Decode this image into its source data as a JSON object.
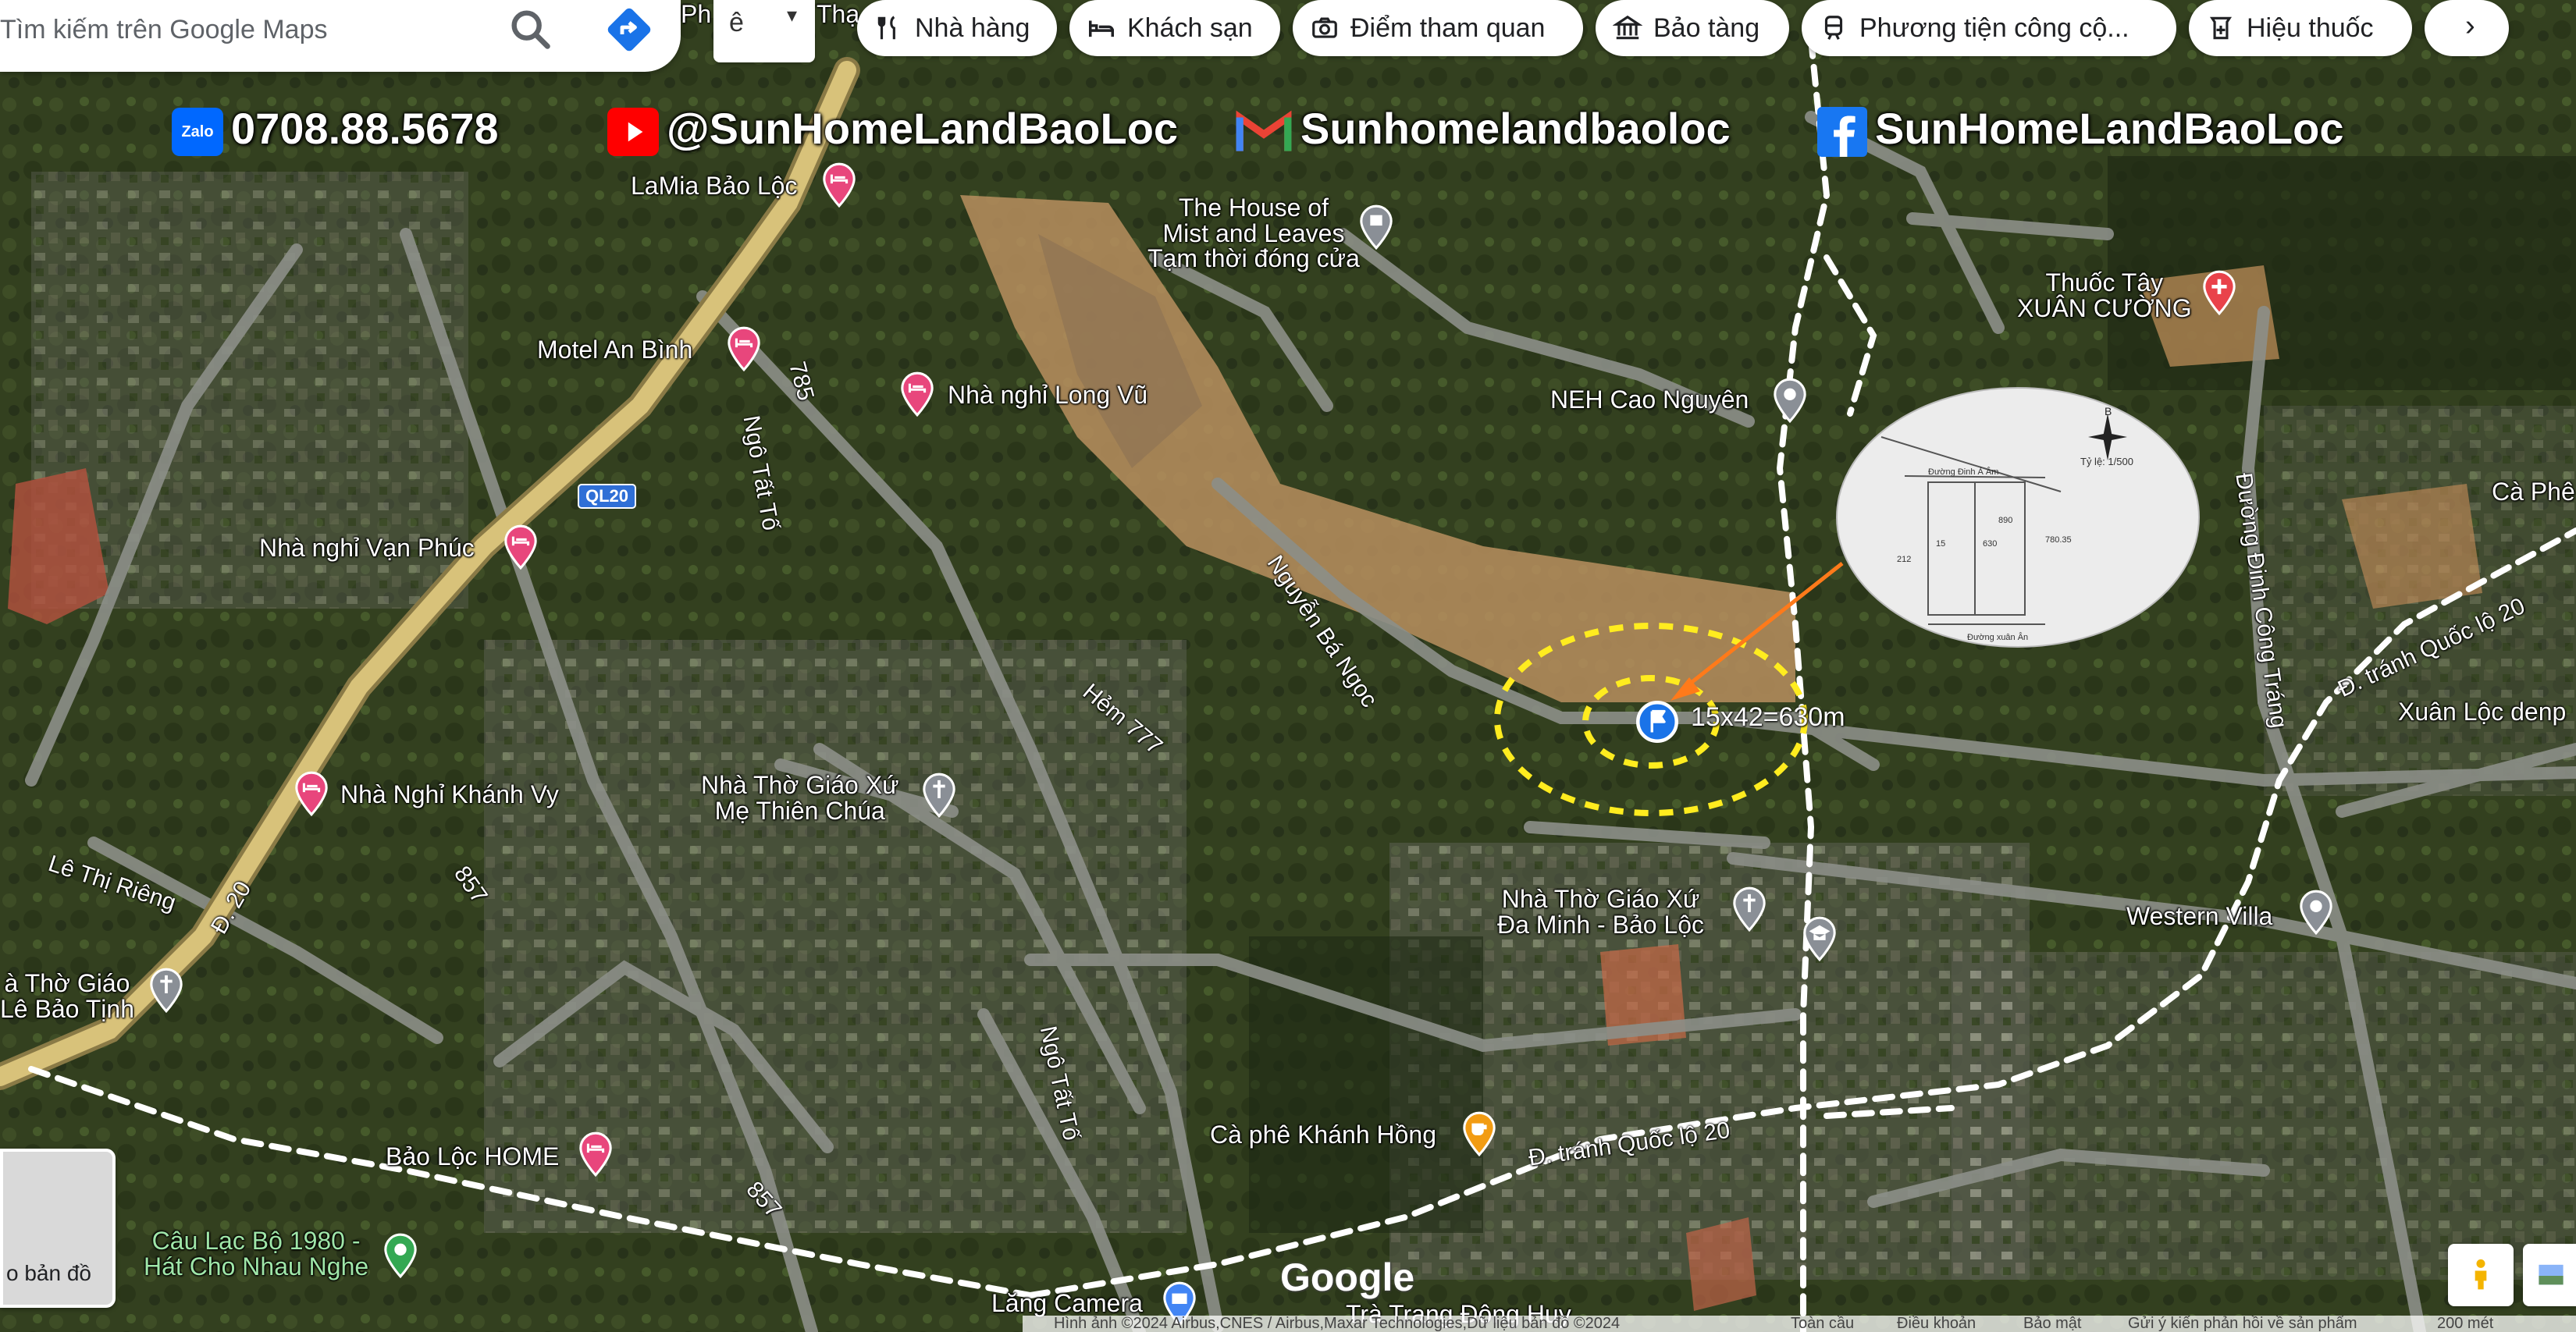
{
  "search": {
    "placeholder": "Tìm kiếm trên Google Maps"
  },
  "top_partial": {
    "left_text": "Ph",
    "right_text": "Thạ"
  },
  "layer_menu": {
    "glyph": "ê",
    "caret": "▾"
  },
  "chips": [
    {
      "label": "Nhà hàng",
      "icon": "fork-knife-icon"
    },
    {
      "label": "Khách sạn",
      "icon": "bed-icon"
    },
    {
      "label": "Điểm tham quan",
      "icon": "camera-icon"
    },
    {
      "label": "Bảo tàng",
      "icon": "museum-icon"
    },
    {
      "label": "Phương tiện công cộ...",
      "icon": "train-icon"
    },
    {
      "label": "Hiệu thuốc",
      "icon": "pharmacy-icon"
    }
  ],
  "chip_next": {
    "label": "›"
  },
  "social": {
    "zalo": "0708.88.5678",
    "youtube": "@SunHomeLandBaoLoc",
    "gmail": "Sunhomelandbaoloc",
    "facebook": "SunHomeLandBaoLoc",
    "zalo_badge": "Zalo"
  },
  "places": {
    "lamia": "LaMia Bảo Lộc",
    "house_mist_1": "The House of",
    "house_mist_2": "Mist and Leaves",
    "house_mist_status": "Tạm thời đóng cửa",
    "thuoc_tay_1": "Thuốc Tây",
    "thuoc_tay_2": "XUÂN CƯỜNG",
    "motel_an_binh": "Motel An Bình",
    "nha_nghi_long_vu": "Nhà nghỉ Long Vũ",
    "neh_cao_nguyen": "NEH Cao Nguyên",
    "nha_nghi_van_phuc": "Nhà nghỉ Vạn Phúc",
    "nha_nghi_khanh_vy": "Nhà Nghỉ Khánh Vy",
    "nha_tho_me_1": "Nhà Thờ Giáo Xứ",
    "nha_tho_me_2": "Mẹ Thiên Chúa",
    "nha_tho_da_minh_1": "Nhà Thờ Giáo Xứ",
    "nha_tho_da_minh_2": "Đa Minh - Bảo Lộc",
    "western_villa": "Western Villa",
    "nha_tho_le_1": "à Thờ Giáo",
    "nha_tho_le_2": "Lê Bảo Tịnh",
    "ca_phe_khanh_hong": "Cà phê Khánh Hồng",
    "bao_loc_home": "Bảo Lộc HOME",
    "clb_1980_1": "Câu Lạc Bộ 1980 -",
    "clb_1980_2": "Hát Cho Nhau Nghe",
    "lang_camera": "Lăng Camera",
    "tra_trang": "Trà Trang Đông Huy",
    "ca_phe_edge": "Cà Phê",
    "xuan_loc_edge": "Xuân Lộc denp"
  },
  "roads": {
    "r785": "785",
    "ngo_tat_to_1": "Ngô Tất Tố",
    "ngo_tat_to_2": "Ngô Tất Tố",
    "ql20": "QL20",
    "nguyen_ba_ngoc": "Nguyễn Bá Ngọc",
    "hem777": "Hẻm 777",
    "dinh_cong_trang": "Đường Đinh Công Tráng",
    "tranh_ql20_ne": "Đ. tránh Quốc lộ 20",
    "tranh_ql20_s": "Đ. tránh Quốc lộ 20",
    "le_thi_rieng": "Lê Thị Riêng",
    "d20": "Đ. 20",
    "r857a": "857",
    "r857b": "857"
  },
  "parcel": {
    "label": "15x42=630m",
    "note_scale": "Tỷ lệ: 1/500",
    "note_north": "B",
    "note_road": "Đường Đinh Ả Âm",
    "note_bottom": "Đường xuân Ân",
    "lot_a": "15",
    "lot_b": "630",
    "lot_c": "890",
    "lot_d": "780.35",
    "lot_e": "212"
  },
  "layer_thumb": {
    "label": "o bản đồ"
  },
  "google_logo": "Google",
  "footer": {
    "attribution": "Hình ảnh ©2024 Airbus,CNES / Airbus,Maxar Technologies,Dữ liệu bản đồ ©2024",
    "region": "Toàn cầu",
    "terms": "Điều khoản",
    "privacy": "Bảo mật",
    "feedback": "Gửi ý kiến phản hồi về sản phẩm",
    "scale": "200 mét"
  },
  "colors": {
    "zalo": "#0068ff",
    "youtube": "#ff0000",
    "facebook": "#1877f2",
    "hotel_pin": "#e8467c",
    "road_dashed": "#ffffff",
    "ql20": "#d8c27a",
    "circle": "#ffec1f",
    "arrow": "#ff7a1a"
  }
}
